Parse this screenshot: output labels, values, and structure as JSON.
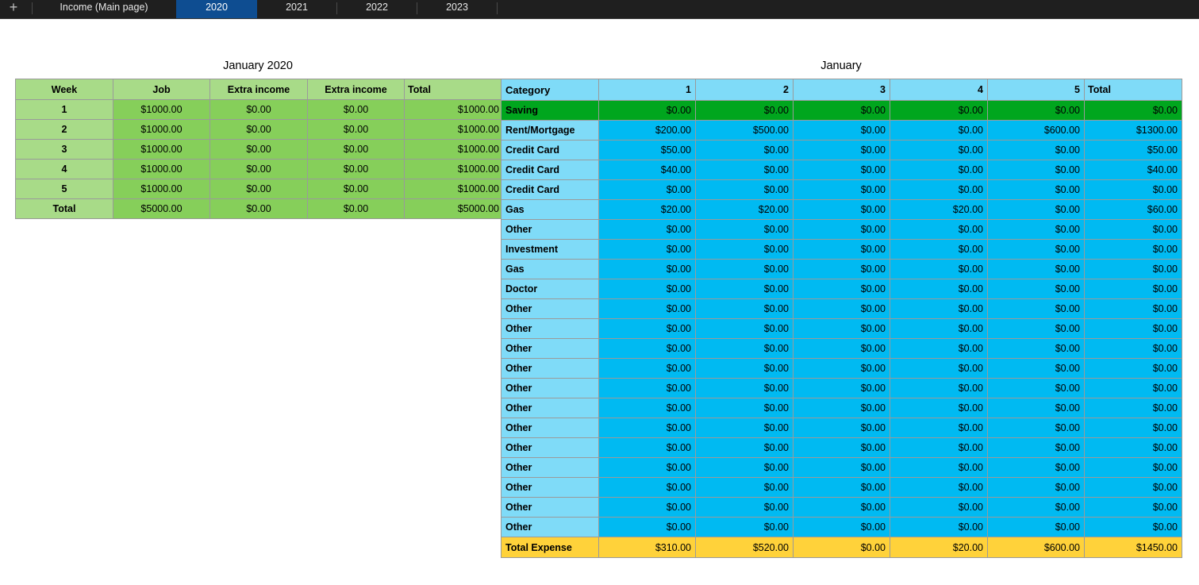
{
  "tabs": {
    "add_label": "+",
    "items": [
      "Income (Main page)",
      "2020",
      "2021",
      "2022",
      "2023"
    ],
    "active": "2020"
  },
  "income": {
    "title": "January 2020",
    "headers": [
      "Week",
      "Job",
      "Extra income",
      "Extra income",
      "Total"
    ],
    "rows": [
      [
        "1",
        "$1000.00",
        "$0.00",
        "$0.00",
        "$1000.00"
      ],
      [
        "2",
        "$1000.00",
        "$0.00",
        "$0.00",
        "$1000.00"
      ],
      [
        "3",
        "$1000.00",
        "$0.00",
        "$0.00",
        "$1000.00"
      ],
      [
        "4",
        "$1000.00",
        "$0.00",
        "$0.00",
        "$1000.00"
      ],
      [
        "5",
        "$1000.00",
        "$0.00",
        "$0.00",
        "$1000.00"
      ],
      [
        "Total",
        "$5000.00",
        "$0.00",
        "$0.00",
        "$5000.00"
      ]
    ]
  },
  "expense": {
    "title": "January",
    "headers": [
      "Category",
      "1",
      "2",
      "3",
      "4",
      "5",
      "Total"
    ],
    "rows": [
      [
        "Saving",
        "$0.00",
        "$0.00",
        "$0.00",
        "$0.00",
        "$0.00",
        "$0.00"
      ],
      [
        "Rent/Mortgage",
        "$200.00",
        "$500.00",
        "$0.00",
        "$0.00",
        "$600.00",
        "$1300.00"
      ],
      [
        "Credit Card",
        "$50.00",
        "$0.00",
        "$0.00",
        "$0.00",
        "$0.00",
        "$50.00"
      ],
      [
        "Credit Card",
        "$40.00",
        "$0.00",
        "$0.00",
        "$0.00",
        "$0.00",
        "$40.00"
      ],
      [
        "Credit Card",
        "$0.00",
        "$0.00",
        "$0.00",
        "$0.00",
        "$0.00",
        "$0.00"
      ],
      [
        "Gas",
        "$20.00",
        "$20.00",
        "$0.00",
        "$20.00",
        "$0.00",
        "$60.00"
      ],
      [
        "Other",
        "$0.00",
        "$0.00",
        "$0.00",
        "$0.00",
        "$0.00",
        "$0.00"
      ],
      [
        "Investment",
        "$0.00",
        "$0.00",
        "$0.00",
        "$0.00",
        "$0.00",
        "$0.00"
      ],
      [
        "Gas",
        "$0.00",
        "$0.00",
        "$0.00",
        "$0.00",
        "$0.00",
        "$0.00"
      ],
      [
        "Doctor",
        "$0.00",
        "$0.00",
        "$0.00",
        "$0.00",
        "$0.00",
        "$0.00"
      ],
      [
        "Other",
        "$0.00",
        "$0.00",
        "$0.00",
        "$0.00",
        "$0.00",
        "$0.00"
      ],
      [
        "Other",
        "$0.00",
        "$0.00",
        "$0.00",
        "$0.00",
        "$0.00",
        "$0.00"
      ],
      [
        "Other",
        "$0.00",
        "$0.00",
        "$0.00",
        "$0.00",
        "$0.00",
        "$0.00"
      ],
      [
        "Other",
        "$0.00",
        "$0.00",
        "$0.00",
        "$0.00",
        "$0.00",
        "$0.00"
      ],
      [
        "Other",
        "$0.00",
        "$0.00",
        "$0.00",
        "$0.00",
        "$0.00",
        "$0.00"
      ],
      [
        "Other",
        "$0.00",
        "$0.00",
        "$0.00",
        "$0.00",
        "$0.00",
        "$0.00"
      ],
      [
        "Other",
        "$0.00",
        "$0.00",
        "$0.00",
        "$0.00",
        "$0.00",
        "$0.00"
      ],
      [
        "Other",
        "$0.00",
        "$0.00",
        "$0.00",
        "$0.00",
        "$0.00",
        "$0.00"
      ],
      [
        "Other",
        "$0.00",
        "$0.00",
        "$0.00",
        "$0.00",
        "$0.00",
        "$0.00"
      ],
      [
        "Other",
        "$0.00",
        "$0.00",
        "$0.00",
        "$0.00",
        "$0.00",
        "$0.00"
      ],
      [
        "Other",
        "$0.00",
        "$0.00",
        "$0.00",
        "$0.00",
        "$0.00",
        "$0.00"
      ],
      [
        "Other",
        "$0.00",
        "$0.00",
        "$0.00",
        "$0.00",
        "$0.00",
        "$0.00"
      ]
    ],
    "total_row": [
      "Total Expense",
      "$310.00",
      "$520.00",
      "$0.00",
      "$20.00",
      "$600.00",
      "$1450.00"
    ]
  },
  "colors": {
    "income_cell": "#86cf5a",
    "income_header": "#a8db88",
    "expense_cell": "#00baf2",
    "expense_header": "#7fdbf8",
    "saving_row": "#00a61e",
    "total_row": "#ffd23a",
    "active_tab": "#0e4d91"
  }
}
